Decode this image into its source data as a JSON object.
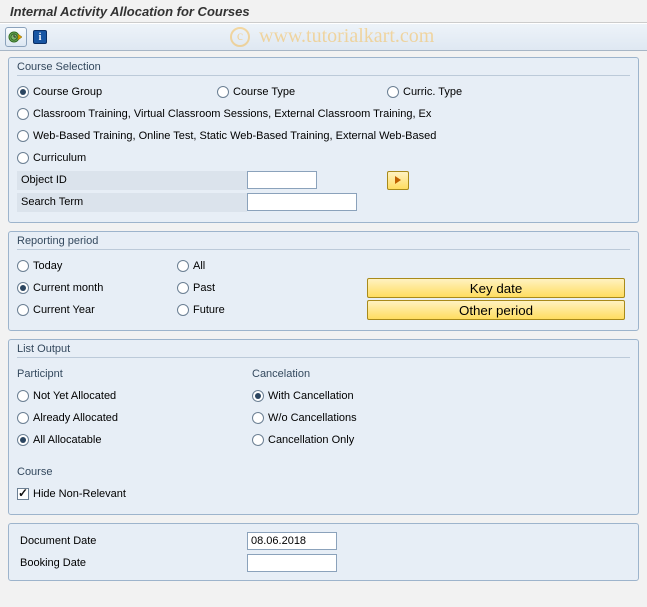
{
  "title": "Internal Activity Allocation for Courses",
  "groups": {
    "courseSelection": {
      "legend": "Course Selection",
      "opt_courseGroup": "Course Group",
      "opt_courseType": "Course Type",
      "opt_curricType": "Curric. Type",
      "opt_classroom": "Classroom Training, Virtual Classroom Sessions, External Classroom Training, Ex",
      "opt_web": "Web-Based Training, Online Test, Static Web-Based Training, External Web-Based",
      "opt_curriculum": "Curriculum",
      "lbl_objectId": "Object ID",
      "lbl_searchTerm": "Search Term",
      "val_objectId": "",
      "val_searchTerm": ""
    },
    "reporting": {
      "legend": "Reporting period",
      "opt_today": "Today",
      "opt_all": "All",
      "opt_currentMonth": "Current month",
      "opt_past": "Past",
      "opt_currentYear": "Current Year",
      "opt_future": "Future",
      "btn_keyDate": "Key date",
      "btn_otherPeriod": "Other period"
    },
    "listOutput": {
      "legend": "List Output",
      "hdr_participant": "Participnt",
      "hdr_cancel": "Cancelation",
      "opt_notYet": "Not Yet Allocated",
      "opt_already": "Already Allocated",
      "opt_allAlloc": "All Allocatable",
      "opt_withCancel": "With Cancellation",
      "opt_woCancel": "W/o Cancellations",
      "opt_cancelOnly": "Cancellation Only",
      "hdr_course": "Course",
      "chk_hide": "Hide Non-Relevant"
    }
  },
  "bottom": {
    "lbl_docDate": "Document Date",
    "lbl_bookDate": "Booking Date",
    "val_docDate": "08.06.2018",
    "val_bookDate": ""
  }
}
